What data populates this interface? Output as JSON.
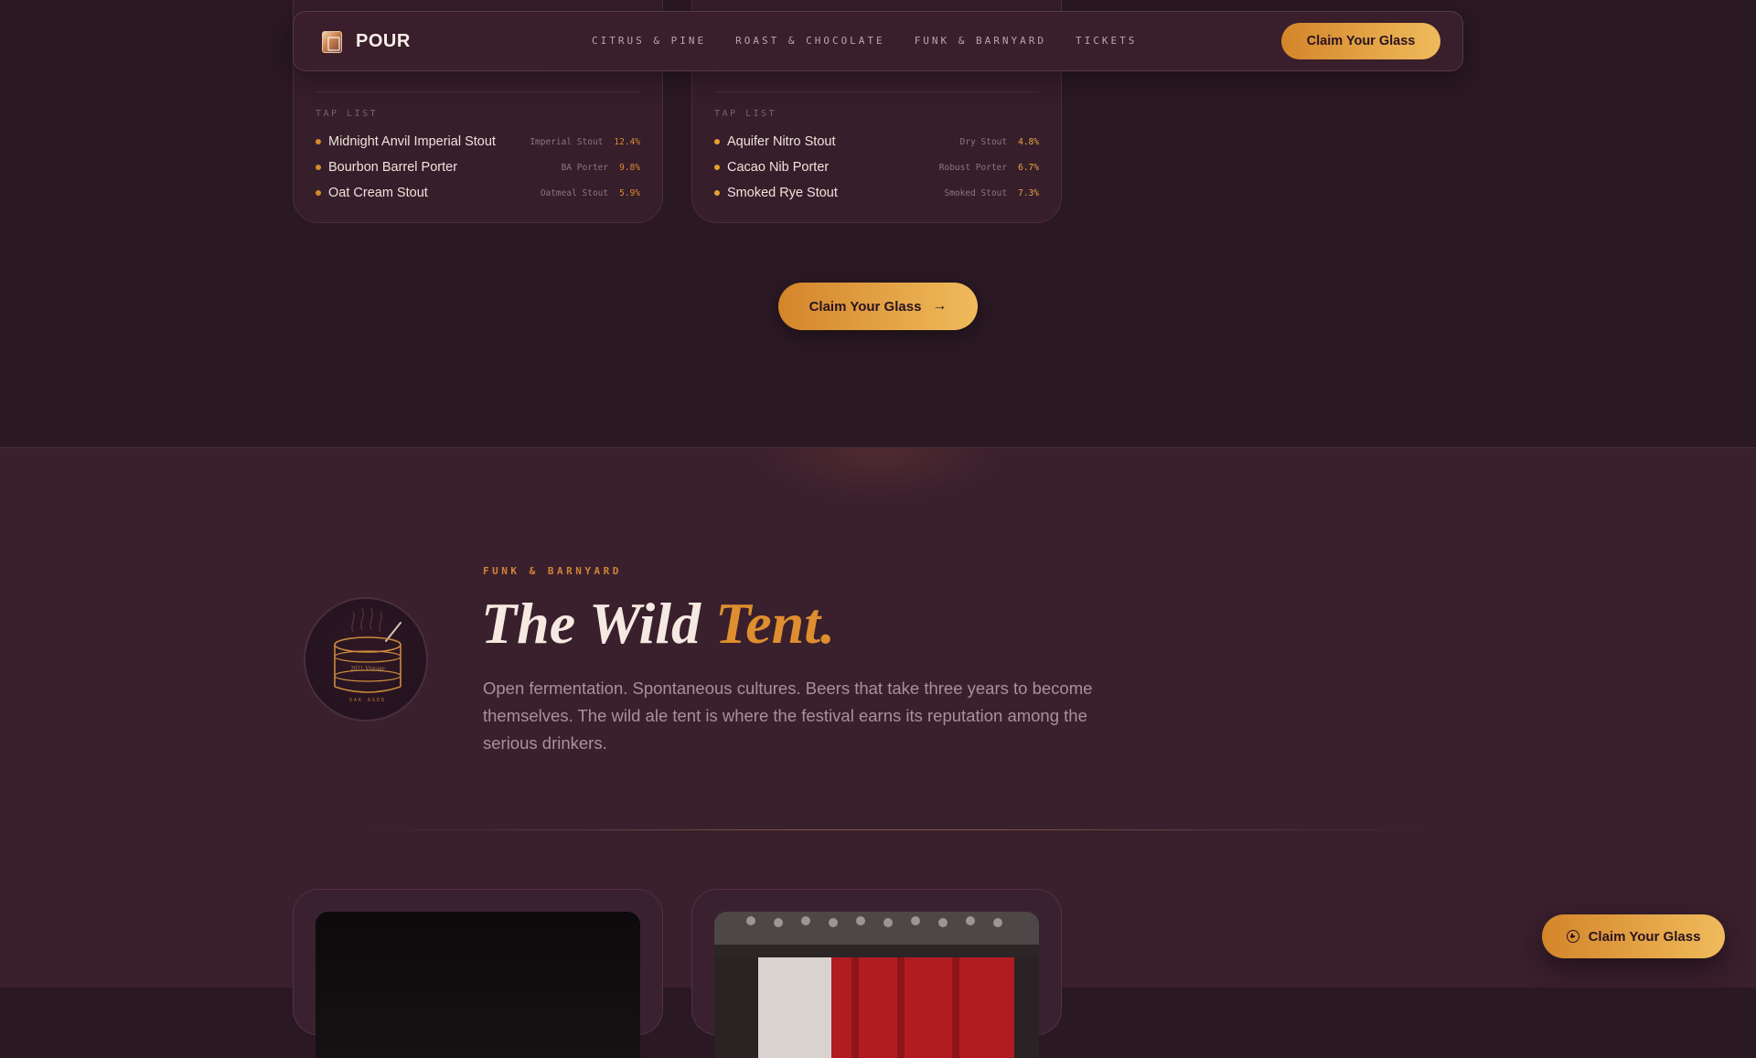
{
  "nav": {
    "brand": "POUR",
    "links": [
      "CITRUS & PINE",
      "ROAST & CHOCOLATE",
      "FUNK & BARNYARD",
      "TICKETS"
    ],
    "cta_label": "Claim Your Glass"
  },
  "cards": [
    {
      "tap_label": "TAP LIST",
      "beers": [
        {
          "name": "Midnight Anvil Imperial Stout",
          "style": "Imperial Stout",
          "abv": "12.4%"
        },
        {
          "name": "Bourbon Barrel Porter",
          "style": "BA Porter",
          "abv": "9.8%"
        },
        {
          "name": "Oat Cream Stout",
          "style": "Oatmeal Stout",
          "abv": "5.9%"
        }
      ]
    },
    {
      "tap_label": "TAP LIST",
      "beers": [
        {
          "name": "Aquifer Nitro Stout",
          "style": "Dry Stout",
          "abv": "4.8%"
        },
        {
          "name": "Cacao Nib Porter",
          "style": "Robust Porter",
          "abv": "6.7%"
        },
        {
          "name": "Smoked Rye Stout",
          "style": "Smoked Stout",
          "abv": "7.3%"
        }
      ]
    }
  ],
  "center_cta_label": "Claim Your Glass",
  "section": {
    "eyebrow": "FUNK & BARNYARD",
    "heading_main": "The Wild ",
    "heading_accent": "Tent.",
    "paragraph": "Open fermentation. Spontaneous cultures. Beers that take three years to become themselves. The wild ale tent is where the festival earns its reputation among the serious drinkers.",
    "badge_text": "2021 Vintage",
    "badge_sub": "OAK AGED"
  },
  "floating_cta_label": "Claim Your Glass",
  "colors": {
    "accent": "#de8e2f",
    "button_gradient_start": "#d4852a",
    "button_gradient_end": "#efbb5c",
    "bg_dark": "#2a1823",
    "bg_section": "#3a1f2d"
  }
}
